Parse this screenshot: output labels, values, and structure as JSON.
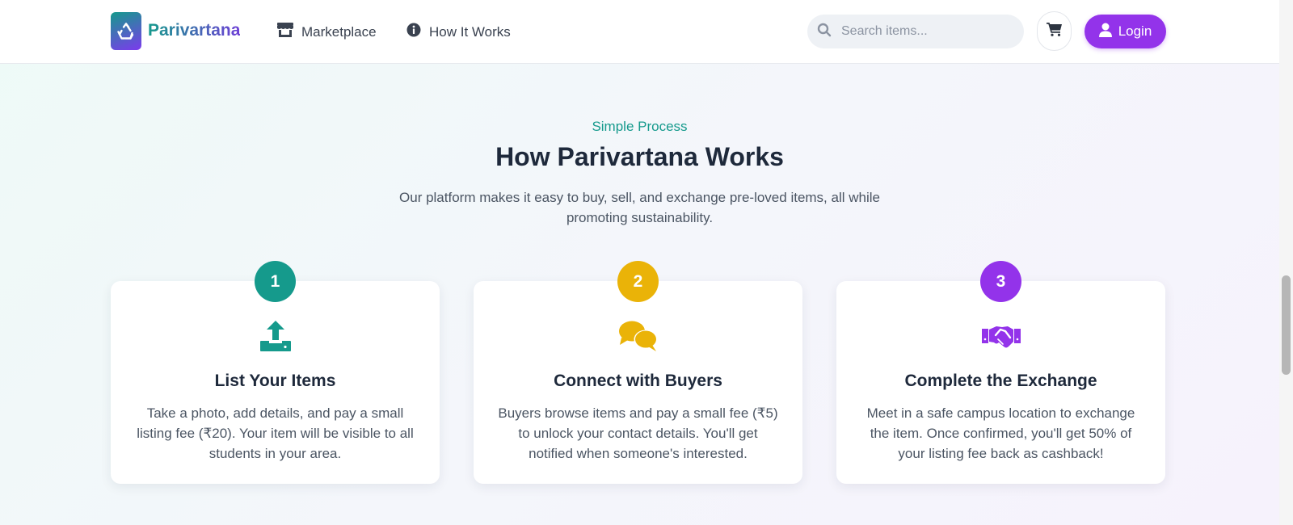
{
  "header": {
    "brand": "Parivartana",
    "nav": [
      {
        "label": "Marketplace",
        "icon": "store-icon"
      },
      {
        "label": "How It Works",
        "icon": "info-circle-icon"
      }
    ],
    "search": {
      "placeholder": "Search items...",
      "value": "",
      "icon": "search-icon"
    },
    "cart_icon": "cart-icon",
    "login_label": "Login"
  },
  "section": {
    "eyebrow": "Simple Process",
    "title": "How Parivartana Works",
    "description": "Our platform makes it easy to buy, sell, and exchange pre-loved items, all while promoting sustainability."
  },
  "steps": [
    {
      "number": "1",
      "color": "#159a8c",
      "icon": "upload-icon",
      "title": "List Your Items",
      "text": "Take a photo, add details, and pay a small listing fee (₹20). Your item will be visible to all students in your area."
    },
    {
      "number": "2",
      "color": "#eab308",
      "icon": "chat-bubbles-icon",
      "title": "Connect with Buyers",
      "text": "Buyers browse items and pay a small fee (₹5) to unlock your contact details. You'll get notified when someone's interested."
    },
    {
      "number": "3",
      "color": "#9333ea",
      "icon": "handshake-icon",
      "title": "Complete the Exchange",
      "text": "Meet in a safe campus location to exchange the item. Once confirmed, you'll get 50% of your listing fee back as cashback!"
    }
  ],
  "colors": {
    "accent_teal": "#159a8c",
    "accent_purple": "#9333ea",
    "accent_yellow": "#eab308"
  }
}
